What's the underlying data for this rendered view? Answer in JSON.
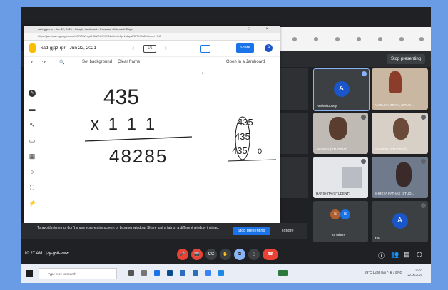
{
  "browser": {
    "tab_title": "xad-gjqz-rpr - Jun 22, 2021 - Google Jamboard - Personal - Microsoft Edge",
    "url": "https://jamboard.google.com/d/1RCWeoy2h3WEGGXES4sDd/Jv5phhdsyMRFTXOaE/viewer?f=2",
    "window_controls": "– □ ×"
  },
  "jamboard": {
    "doc_title": "xad-gjqz-rpr - Jun 22, 2021",
    "frame_indicator": "1/1",
    "prev": "‹",
    "next": "›",
    "share_label": "Share",
    "avatar_letter": "A",
    "more": "⋮",
    "tools": {
      "undo": "↶",
      "redo": "↷",
      "zoom": "🔍",
      "set_background": "Set background",
      "clear_frame": "Clear frame",
      "open_in_jamboard": "Open in a Jamboard"
    },
    "side_tools": [
      "✎",
      "▬",
      "↖",
      "▭",
      "▦",
      "○",
      "⛶",
      "⚡"
    ],
    "board": {
      "line1": "435",
      "line2": "x 1 1 1",
      "result": "48285",
      "tick": "'",
      "side_column": [
        "435",
        "435",
        "435",
        "0"
      ]
    }
  },
  "presentation_banner": {
    "message": "To avoid mirroring, don't share your entire screen or browser window. Share just a tab or a different window instead.",
    "stop_button": "Stop presenting",
    "ignore_button": "Ignore"
  },
  "meet": {
    "stop_presenting_top": "Stop presenting",
    "participants": [
      {
        "name": "Anshul Dubey",
        "avatar": "A",
        "color": "#1a56c9"
      },
      {
        "name": "AMOLIKA GOYAL (STUD...",
        "avatar": "",
        "color": ""
      },
      {
        "name": "ANVESH (STUDENT)",
        "avatar": "",
        "color": ""
      },
      {
        "name": "BHAVISH (STUDENT)",
        "avatar": "",
        "color": ""
      },
      {
        "name": "HARSHITA (STUDENT)",
        "avatar": "",
        "color": ""
      },
      {
        "name": "SHREYA PATHAK (STUD...",
        "avatar": "",
        "color": ""
      },
      {
        "name": "",
        "avatar": "",
        "color": ""
      },
      {
        "name": "You",
        "avatar": "A",
        "color": "#1a56c9"
      }
    ],
    "others": {
      "label": "25 others",
      "avatars": [
        "S",
        "B"
      ],
      "colors": [
        "#b06030",
        "#1a73e8"
      ]
    },
    "bottom": {
      "time_code": "10:27 AM | jzy-gsfi-vww",
      "controls": [
        {
          "icon": "🎤",
          "color": "#ea4335"
        },
        {
          "icon": "📷",
          "color": "#ea4335"
        },
        {
          "icon": "CC",
          "color": "#3c4043"
        },
        {
          "icon": "✋",
          "color": "#3c4043"
        },
        {
          "icon": "⧉",
          "color": "#8ab4f8"
        },
        {
          "icon": "⋮",
          "color": "#3c4043"
        },
        {
          "icon": "☎",
          "color": "#ea4335"
        }
      ],
      "right_icons": [
        "ⓘ",
        "👥",
        "▤",
        "⬡"
      ]
    }
  },
  "taskbar": {
    "search_placeholder": "Type here to search",
    "tray_text": "29°C Light rain ^ ⊕ ♪ ENG",
    "time": "10:27",
    "date": "22-06-2021"
  }
}
